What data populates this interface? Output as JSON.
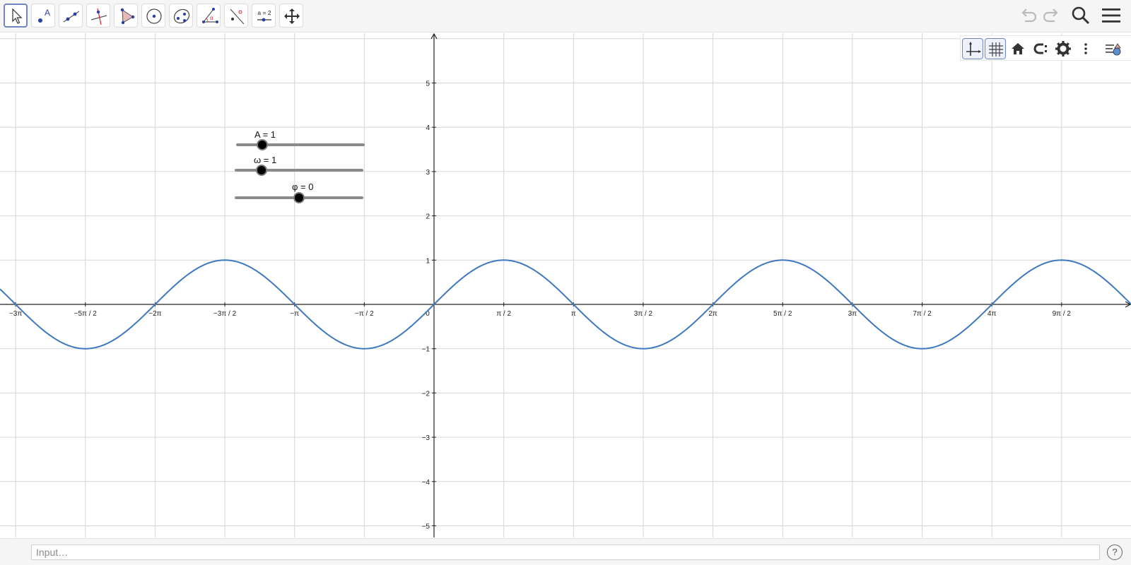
{
  "toolbar": {
    "tools": [
      {
        "name": "move-tool",
        "active": true
      },
      {
        "name": "point-tool",
        "letter": "A"
      },
      {
        "name": "line-tool"
      },
      {
        "name": "perpendicular-line-tool"
      },
      {
        "name": "polygon-tool"
      },
      {
        "name": "circle-center-point-tool"
      },
      {
        "name": "conic-five-points-tool"
      },
      {
        "name": "angle-tool",
        "letter": "α"
      },
      {
        "name": "reflect-about-line-tool"
      },
      {
        "name": "slider-tool",
        "label": "a = 2"
      },
      {
        "name": "move-graphics-view-tool"
      }
    ],
    "right_icons": [
      "undo-icon",
      "redo-icon",
      "search-icon",
      "menu-icon"
    ]
  },
  "stylebar": {
    "icons": [
      "axes-icon",
      "grid-icon",
      "home-icon",
      "point-capturing-icon",
      "gear-icon",
      "more-vertical-icon",
      "algebra-view-icon"
    ]
  },
  "sliders": [
    {
      "name": "A",
      "label": "A = 1",
      "value": 1
    },
    {
      "name": "omega",
      "label": "ω = 1",
      "value": 1
    },
    {
      "name": "phi",
      "label": "φ = 0",
      "value": 0
    }
  ],
  "chart_data": {
    "type": "line",
    "function": "y = A·sin(ω·x + φ)",
    "series": [
      {
        "amplitude": 1,
        "omega": 1,
        "phase": 0
      }
    ],
    "xlim": [
      -9.6,
      15.6
    ],
    "ylim": [
      -5.4,
      6.1
    ],
    "x_tick_step": "π/2",
    "x_tick_labels": [
      "−3π",
      "−5π / 2",
      "−2π",
      "−3π / 2",
      "−π",
      "−π / 2",
      "0",
      "π / 2",
      "π",
      "3π / 2",
      "2π",
      "5π / 2",
      "3π",
      "7π / 2",
      "4π",
      "9π / 2"
    ],
    "y_tick_labels": [
      "−5",
      "−4",
      "−3",
      "−2",
      "−1",
      "1",
      "2",
      "3",
      "4",
      "5"
    ],
    "grid": true,
    "curve_color": "#3d78c0"
  },
  "inputbar": {
    "placeholder": "Input…",
    "help": "?"
  }
}
